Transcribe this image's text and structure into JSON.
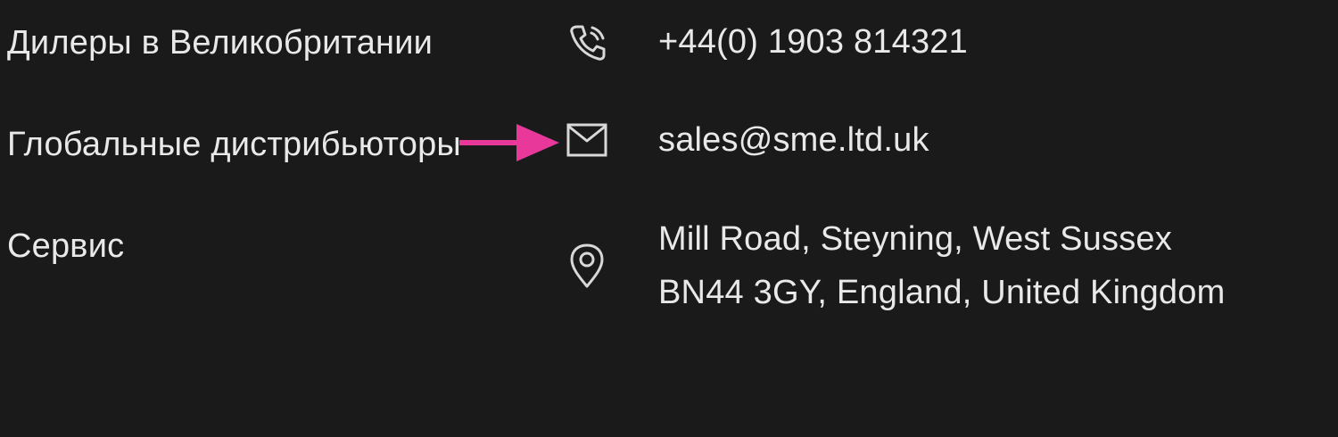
{
  "nav": {
    "dealers_uk": "Дилеры в Великобритании",
    "global_distributors": "Глобальные дистрибьюторы",
    "service": "Сервис"
  },
  "contact": {
    "phone": "+44(0) 1903 814321",
    "email": "sales@sme.ltd.uk",
    "address_line1": "Mill Road, Steyning, West Sussex",
    "address_line2": "BN44 3GY, England, United Kingdom"
  },
  "icons": {
    "phone": "phone-icon",
    "email": "envelope-icon",
    "location": "location-pin-icon",
    "annotation": "arrow-right-icon"
  },
  "colors": {
    "background": "#1b1a1b",
    "text": "#e9e9e9",
    "icon": "#d8d8d8",
    "annotation_arrow": "#e8399a"
  }
}
